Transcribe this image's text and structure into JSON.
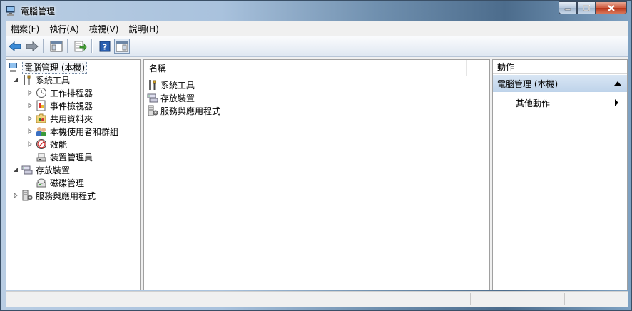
{
  "window": {
    "title": "電腦管理"
  },
  "menu": [
    {
      "label": "檔案(F)"
    },
    {
      "label": "執行(A)"
    },
    {
      "label": "檢視(V)"
    },
    {
      "label": "說明(H)"
    }
  ],
  "toolbar": {
    "icons": [
      "back-arrow-icon",
      "forward-arrow-icon",
      "show-hide-console-tree-icon",
      "export-list-icon",
      "help-icon",
      "show-hide-action-pane-icon"
    ]
  },
  "tree": {
    "root": {
      "label": "電腦管理 (本機)"
    },
    "system_tools": {
      "label": "系統工具"
    },
    "task_scheduler": {
      "label": "工作排程器"
    },
    "event_viewer": {
      "label": "事件檢視器"
    },
    "shared_folders": {
      "label": "共用資料夾"
    },
    "local_users_groups": {
      "label": "本機使用者和群組"
    },
    "performance": {
      "label": "效能"
    },
    "device_manager": {
      "label": "裝置管理員"
    },
    "storage": {
      "label": "存放裝置"
    },
    "disk_management": {
      "label": "磁碟管理"
    },
    "services_apps": {
      "label": "服務與應用程式"
    }
  },
  "center": {
    "column_name": "名稱",
    "items": [
      {
        "label": "系統工具"
      },
      {
        "label": "存放裝置"
      },
      {
        "label": "服務與應用程式"
      }
    ]
  },
  "actions": {
    "header": "動作",
    "section": "電腦管理 (本機)",
    "more": "其他動作"
  },
  "colors": {
    "accent_section": "#c4d8ee",
    "pane_border": "#a0a0a0"
  }
}
